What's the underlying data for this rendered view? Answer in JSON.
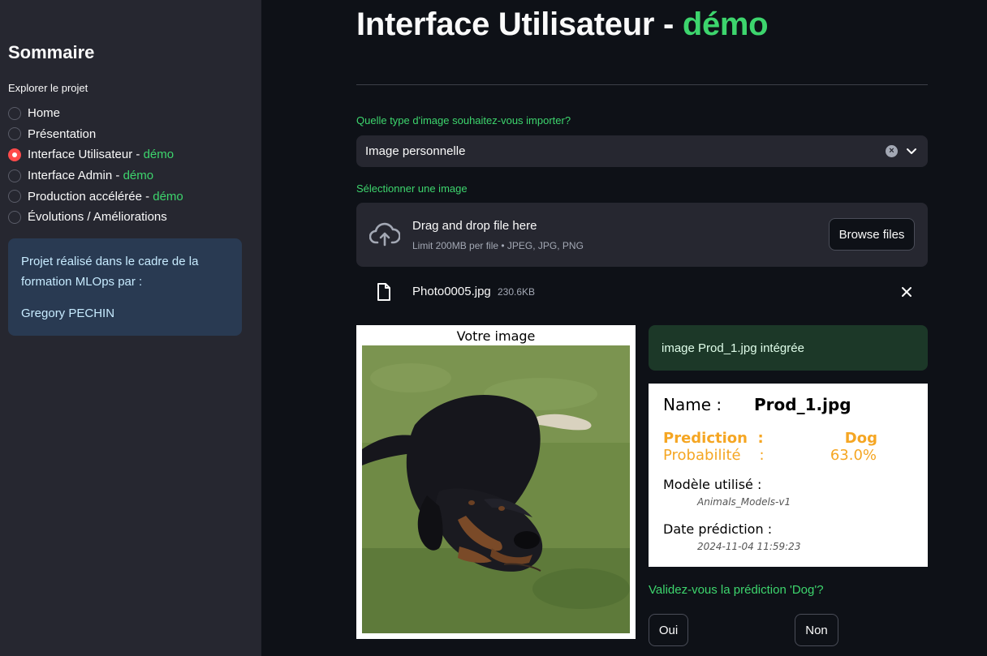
{
  "sidebar": {
    "title": "Sommaire",
    "radio_label": "Explorer le projet",
    "items": [
      {
        "label": "Home",
        "suffix": ""
      },
      {
        "label": "Présentation",
        "suffix": ""
      },
      {
        "label": "Interface Utilisateur - ",
        "suffix": "démo"
      },
      {
        "label": "Interface Admin - ",
        "suffix": "démo"
      },
      {
        "label": "Production accélérée - ",
        "suffix": "démo"
      },
      {
        "label": "Évolutions / Améliorations",
        "suffix": ""
      }
    ],
    "selected_index": 2,
    "info": {
      "text": "Projet réalisé dans le cadre de la formation MLOps par :",
      "author": "Gregory PECHIN"
    }
  },
  "main": {
    "title": "Interface Utilisateur - ",
    "title_accent": "démo",
    "select_label": "Quelle type d'image souhaitez-vous importer?",
    "select_value": "Image personnelle",
    "uploader_label": "Sélectionner une image",
    "uploader_main": "Drag and drop file here",
    "uploader_sub": "Limit 200MB per file • JPEG, JPG, PNG",
    "browse_label": "Browse files",
    "file": {
      "name": "Photo0005.jpg",
      "size": "230.6KB"
    },
    "image_caption": "Votre image",
    "success_msg": "image Prod_1.jpg intégrée",
    "prediction": {
      "name_label": "Name :",
      "name_value": "Prod_1.jpg",
      "pred_label": "Prediction  :",
      "pred_value": "Dog",
      "prob_label": "Probabilité    :",
      "prob_value": "63.0%",
      "model_label": "Modèle utilisé :",
      "model_value": "Animals_Models-v1",
      "date_label": "Date prédiction :",
      "date_value": "2024-11-04 11:59:23"
    },
    "validate_question": "Validez-vous la prédiction 'Dog'?",
    "yes_label": "Oui",
    "no_label": "Non"
  },
  "colors": {
    "accent_green": "#3dd56d",
    "primary_red": "#ff4b4b",
    "orange": "#f5a623"
  }
}
